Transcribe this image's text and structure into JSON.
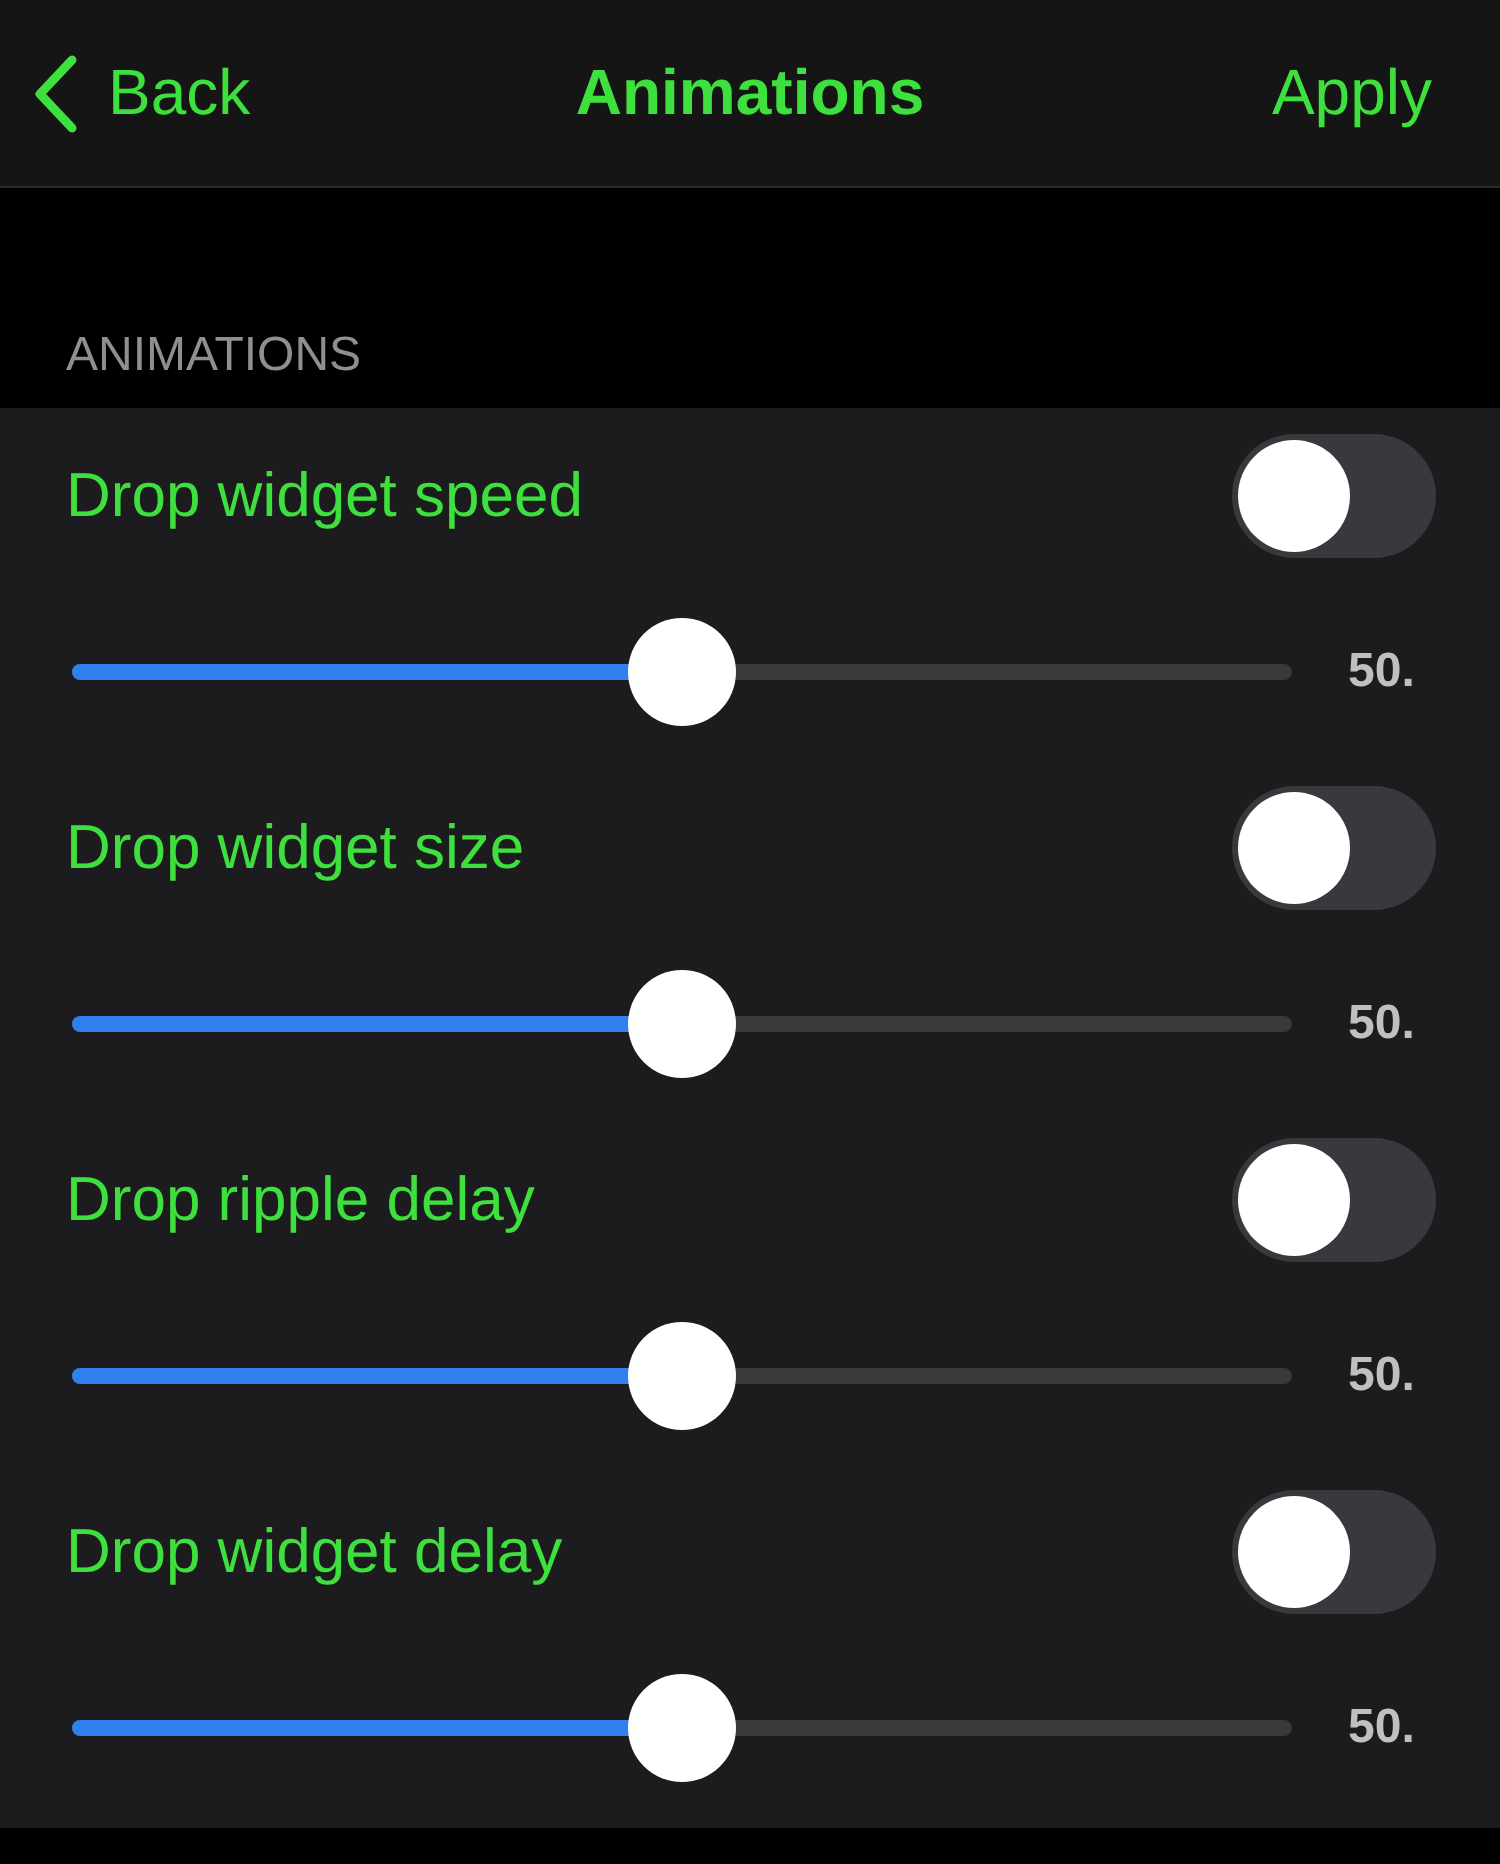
{
  "nav": {
    "back": "Back",
    "title": "Animations",
    "action": "Apply"
  },
  "section": {
    "header": "ANIMATIONS"
  },
  "settings": [
    {
      "label": "Drop widget speed",
      "on": false,
      "level": 0.5,
      "reading": "50."
    },
    {
      "label": "Drop widget size",
      "on": false,
      "level": 0.5,
      "reading": "50."
    },
    {
      "label": "Drop ripple delay",
      "on": false,
      "level": 0.5,
      "reading": "50."
    },
    {
      "label": "Drop widget delay",
      "on": false,
      "level": 0.5,
      "reading": "50."
    }
  ]
}
